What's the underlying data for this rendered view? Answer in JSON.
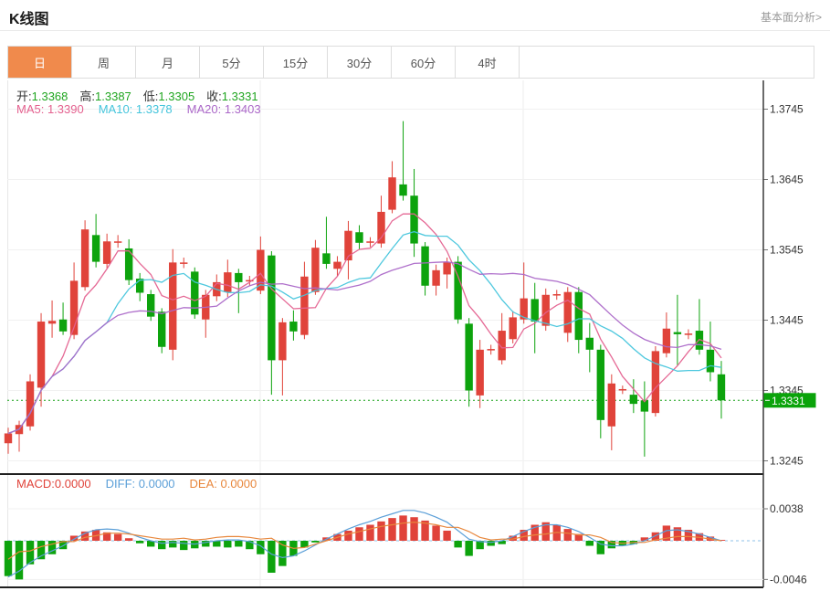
{
  "page": {
    "title": "K线图",
    "top_link": "基本面分析>"
  },
  "tabs": [
    {
      "label": "日",
      "active": true
    },
    {
      "label": "周"
    },
    {
      "label": "月"
    },
    {
      "label": "5分"
    },
    {
      "label": "15分"
    },
    {
      "label": "30分"
    },
    {
      "label": "60分"
    },
    {
      "label": "4时"
    }
  ],
  "legend_ohlc": [
    {
      "label": "开:",
      "value": "1.3368"
    },
    {
      "label": "高:",
      "value": "1.3387"
    },
    {
      "label": "低:",
      "value": "1.3305"
    },
    {
      "label": "收:",
      "value": "1.3331"
    }
  ],
  "legend_ma": [
    {
      "text": "MA5: 1.3390",
      "color": "#e4618f"
    },
    {
      "text": "MA10: 1.3378",
      "color": "#45c5dc"
    },
    {
      "text": "MA20: 1.3403",
      "color": "#ab68c8"
    }
  ],
  "legend_macd": [
    {
      "text": "MACD:0.0000",
      "color": "#e0433a"
    },
    {
      "text": "DIFF: 0.0000",
      "color": "#5b9fd8"
    },
    {
      "text": "DEA: 0.0000",
      "color": "#e8873c"
    }
  ],
  "chart_data": {
    "type": "candlestick",
    "title": "K线图",
    "interval_selected": "日",
    "y_axis": {
      "ticks": [
        1.3745,
        1.3645,
        1.3545,
        1.3445,
        1.3345,
        1.3245
      ]
    },
    "current_price": 1.3331,
    "ohlc_last": {
      "open": 1.3368,
      "high": 1.3387,
      "low": 1.3305,
      "close": 1.3331
    },
    "ma_last": {
      "ma5": 1.339,
      "ma10": 1.3378,
      "ma20": 1.3403
    },
    "ma_periods": [
      5,
      10,
      20
    ],
    "colors": {
      "up": "#e0433a",
      "down": "#0da30d",
      "ma5": "#e4618f",
      "ma10": "#45c5dc",
      "ma20": "#ab68c8",
      "diff": "#5b9fd8",
      "dea": "#e8873c",
      "price_tag_bg": "#0aa30a",
      "dotted_line": "#14a114",
      "tab_accent": "#f08a4c"
    },
    "candles": [
      [
        1.327,
        1.3292,
        1.3255,
        1.3284
      ],
      [
        1.3283,
        1.3302,
        1.3258,
        1.3296
      ],
      [
        1.3294,
        1.3368,
        1.3288,
        1.3358
      ],
      [
        1.3349,
        1.3455,
        1.3322,
        1.3443
      ],
      [
        1.344,
        1.3473,
        1.342,
        1.3444
      ],
      [
        1.3446,
        1.347,
        1.3424,
        1.3429
      ],
      [
        1.3424,
        1.3527,
        1.3418,
        1.3501
      ],
      [
        1.3492,
        1.3587,
        1.3487,
        1.3574
      ],
      [
        1.3566,
        1.3596,
        1.352,
        1.3528
      ],
      [
        1.3525,
        1.3568,
        1.3519,
        1.3557
      ],
      [
        1.3555,
        1.3566,
        1.3548,
        1.3557
      ],
      [
        1.3547,
        1.356,
        1.3495,
        1.3502
      ],
      [
        1.3504,
        1.3512,
        1.3472,
        1.3484
      ],
      [
        1.3482,
        1.3488,
        1.3444,
        1.345
      ],
      [
        1.3457,
        1.3462,
        1.3398,
        1.3407
      ],
      [
        1.3403,
        1.3546,
        1.3388,
        1.3527
      ],
      [
        1.3525,
        1.3534,
        1.3519,
        1.3527
      ],
      [
        1.3514,
        1.352,
        1.3447,
        1.3453
      ],
      [
        1.3446,
        1.3488,
        1.342,
        1.3481
      ],
      [
        1.3479,
        1.351,
        1.3472,
        1.3499
      ],
      [
        1.3485,
        1.3531,
        1.3478,
        1.3513
      ],
      [
        1.3512,
        1.3518,
        1.3455,
        1.3499
      ],
      [
        1.35,
        1.3508,
        1.3494,
        1.3502
      ],
      [
        1.3487,
        1.3564,
        1.3482,
        1.3545
      ],
      [
        1.3537,
        1.3543,
        1.3339,
        1.3388
      ],
      [
        1.3388,
        1.3448,
        1.3338,
        1.3442
      ],
      [
        1.3443,
        1.3459,
        1.3416,
        1.3429
      ],
      [
        1.3424,
        1.3528,
        1.3418,
        1.3507
      ],
      [
        1.3485,
        1.3559,
        1.3481,
        1.3548
      ],
      [
        1.354,
        1.3592,
        1.3518,
        1.3525
      ],
      [
        1.3518,
        1.3536,
        1.3508,
        1.3528
      ],
      [
        1.353,
        1.3586,
        1.3503,
        1.3572
      ],
      [
        1.357,
        1.358,
        1.3545,
        1.3555
      ],
      [
        1.3555,
        1.3563,
        1.3549,
        1.3557
      ],
      [
        1.3554,
        1.3622,
        1.3548,
        1.3599
      ],
      [
        1.3602,
        1.3671,
        1.3597,
        1.3648
      ],
      [
        1.3638,
        1.3728,
        1.3615,
        1.3622
      ],
      [
        1.3622,
        1.366,
        1.3535,
        1.3554
      ],
      [
        1.355,
        1.3556,
        1.348,
        1.3494
      ],
      [
        1.3494,
        1.3524,
        1.348,
        1.3516
      ],
      [
        1.351,
        1.3534,
        1.349,
        1.3527
      ],
      [
        1.3528,
        1.3536,
        1.344,
        1.3446
      ],
      [
        1.344,
        1.3448,
        1.3322,
        1.3345
      ],
      [
        1.3338,
        1.3417,
        1.332,
        1.3403
      ],
      [
        1.3402,
        1.341,
        1.3396,
        1.3404
      ],
      [
        1.3388,
        1.3455,
        1.3382,
        1.343
      ],
      [
        1.3418,
        1.3458,
        1.3412,
        1.3449
      ],
      [
        1.3446,
        1.3527,
        1.344,
        1.3476
      ],
      [
        1.3475,
        1.3498,
        1.3398,
        1.3443
      ],
      [
        1.3437,
        1.349,
        1.343,
        1.3481
      ],
      [
        1.348,
        1.3488,
        1.3474,
        1.3482
      ],
      [
        1.3427,
        1.3492,
        1.3414,
        1.3485
      ],
      [
        1.3485,
        1.3492,
        1.3398,
        1.3417
      ],
      [
        1.342,
        1.3441,
        1.3371,
        1.3403
      ],
      [
        1.3403,
        1.341,
        1.3277,
        1.3303
      ],
      [
        1.3294,
        1.3368,
        1.326,
        1.3355
      ],
      [
        1.3345,
        1.3352,
        1.334,
        1.3347
      ],
      [
        1.3339,
        1.3361,
        1.3313,
        1.3326
      ],
      [
        1.3331,
        1.3358,
        1.3251,
        1.3315
      ],
      [
        1.3313,
        1.3408,
        1.3308,
        1.3401
      ],
      [
        1.3398,
        1.3456,
        1.3392,
        1.3433
      ],
      [
        1.3428,
        1.3481,
        1.3381,
        1.3425
      ],
      [
        1.3424,
        1.3432,
        1.3418,
        1.3426
      ],
      [
        1.343,
        1.3475,
        1.3396,
        1.3403
      ],
      [
        1.3403,
        1.3443,
        1.3358,
        1.3371
      ],
      [
        1.3368,
        1.3387,
        1.3305,
        1.3331
      ]
    ],
    "macd": {
      "label_macd": 0.0,
      "label_diff": 0.0,
      "label_dea": 0.0,
      "y_ticks": [
        0.0038,
        -0.0046
      ],
      "hist": [
        -0.0042,
        -0.0046,
        -0.0028,
        -0.0022,
        -0.0016,
        -0.001,
        0.0006,
        0.0011,
        0.0013,
        0.001,
        0.0008,
        0.0003,
        -0.0003,
        -0.0007,
        -0.001,
        -0.0008,
        -0.0011,
        -0.0009,
        -0.0007,
        -0.0007,
        -0.0008,
        -0.0007,
        -0.001,
        -0.0016,
        -0.0038,
        -0.003,
        -0.0018,
        -0.0008,
        -0.0002,
        0.0004,
        0.0008,
        0.0012,
        0.0016,
        0.0019,
        0.0023,
        0.0027,
        0.003,
        0.0028,
        0.0024,
        0.0018,
        0.0012,
        -0.0008,
        -0.0018,
        -0.001,
        -0.0006,
        -0.0004,
        0.0006,
        0.0013,
        0.0019,
        0.0022,
        0.0019,
        0.0014,
        0.0008,
        -0.0006,
        -0.0016,
        -0.0009,
        -0.0006,
        -0.0004,
        0.0004,
        0.001,
        0.0018,
        0.0016,
        0.0013,
        0.0009,
        0.0005,
        0.0001
      ],
      "diff": [
        -0.0043,
        -0.0036,
        -0.0026,
        -0.0018,
        -0.0012,
        -0.0006,
        0.0002,
        0.0009,
        0.0013,
        0.0014,
        0.0013,
        0.0009,
        0.0004,
        0.0,
        -0.0003,
        -0.0002,
        -0.0003,
        -0.0004,
        -0.0002,
        0.0,
        0.0001,
        0.0001,
        -0.0001,
        -0.0006,
        -0.0016,
        -0.002,
        -0.0018,
        -0.0012,
        -0.0005,
        0.0002,
        0.0008,
        0.0014,
        0.0019,
        0.0023,
        0.0028,
        0.0032,
        0.0036,
        0.0036,
        0.0033,
        0.0028,
        0.0022,
        0.0012,
        0.0002,
        -0.0001,
        -0.0002,
        0.0,
        0.0005,
        0.0011,
        0.0016,
        0.0019,
        0.0019,
        0.0016,
        0.0011,
        0.0004,
        -0.0004,
        -0.0006,
        -0.0006,
        -0.0004,
        0.0,
        0.0006,
        0.0012,
        0.0013,
        0.0011,
        0.0008,
        0.0004,
        0.0
      ],
      "dea": [
        -0.0022,
        -0.0013,
        -0.0012,
        -0.0007,
        -0.0004,
        -0.0001,
        -0.0001,
        0.0004,
        0.0006,
        0.0009,
        0.0009,
        0.0008,
        0.0006,
        0.0004,
        0.0002,
        0.0002,
        0.0003,
        0.0001,
        0.0002,
        0.0004,
        0.0005,
        0.0005,
        0.0004,
        0.0002,
        0.0003,
        -0.0005,
        -0.0009,
        -0.0008,
        -0.0004,
        0.0,
        0.0004,
        0.0008,
        0.0011,
        0.0014,
        0.0017,
        0.0019,
        0.0021,
        0.0022,
        0.0021,
        0.0019,
        0.0016,
        0.0016,
        0.0011,
        0.0004,
        0.0001,
        0.0002,
        0.0002,
        0.0005,
        0.0007,
        0.0008,
        0.001,
        0.0009,
        0.0007,
        0.0007,
        0.0004,
        -0.0002,
        -0.0003,
        -0.0002,
        -0.0002,
        0.0001,
        0.0003,
        0.0005,
        0.0005,
        0.0004,
        0.0002,
        0.0
      ]
    }
  }
}
